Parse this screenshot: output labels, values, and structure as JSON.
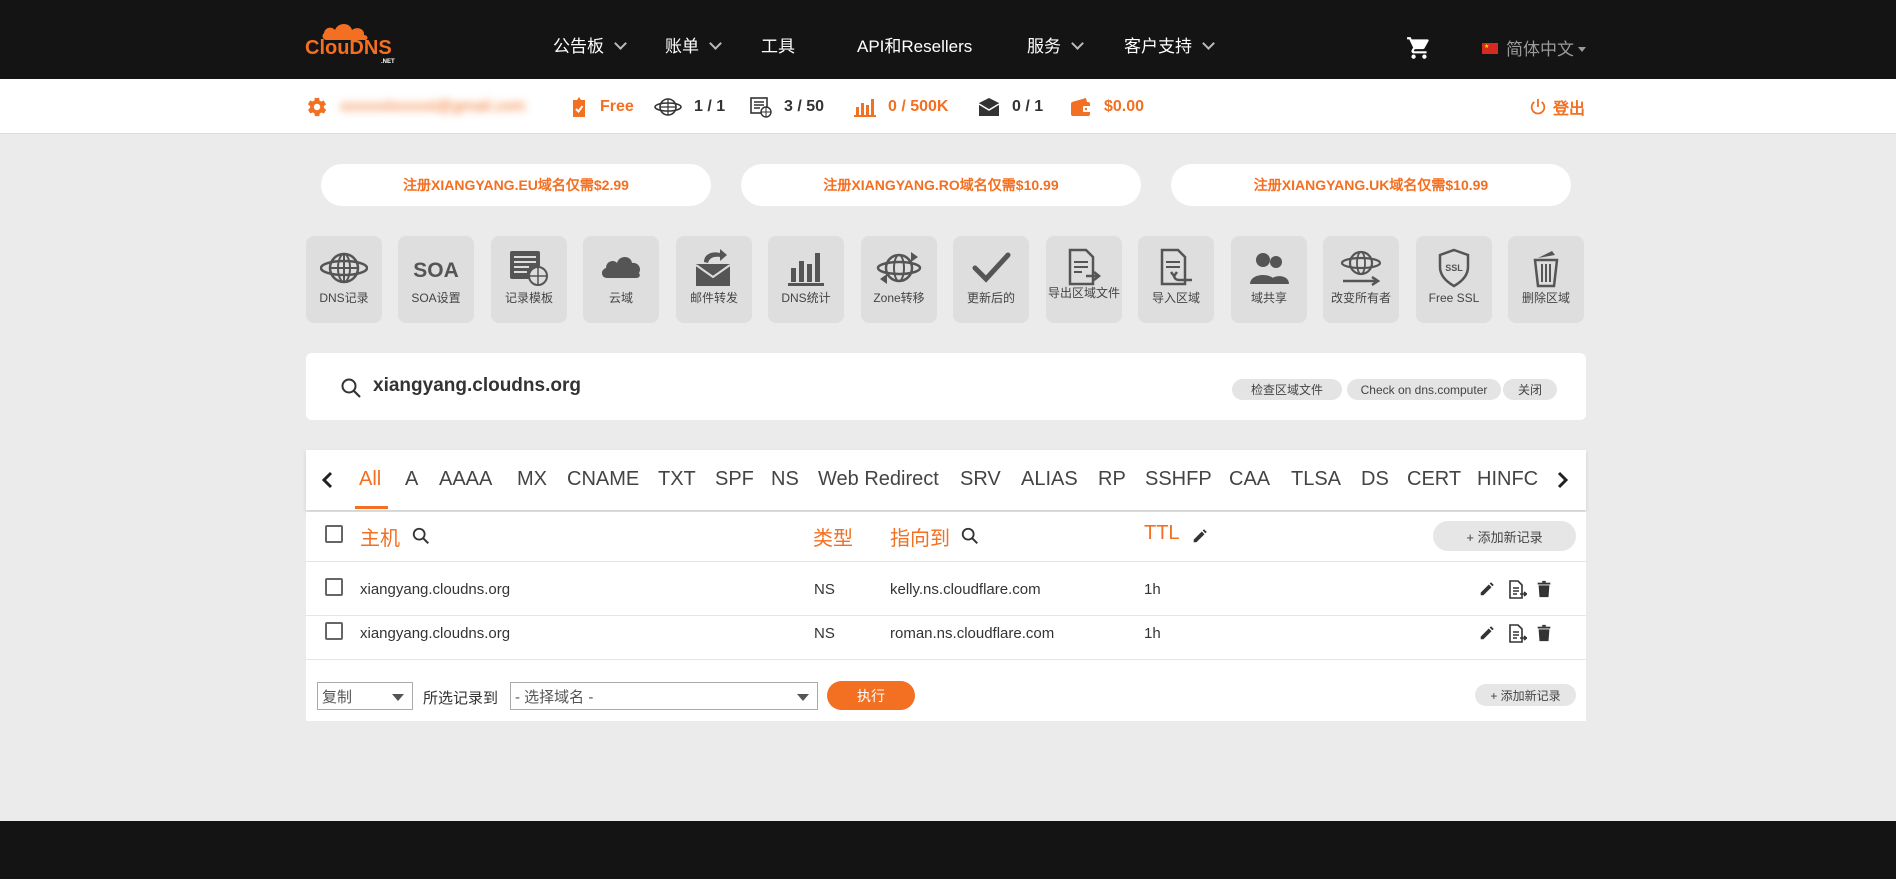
{
  "brand": {
    "logo_text": "ClouDNS",
    "logo_sub": ".NET",
    "accent": "#f36f21"
  },
  "nav": {
    "items": [
      {
        "label": "公告板"
      },
      {
        "label": "账单"
      },
      {
        "label": "工具"
      },
      {
        "label": "API和Resellers"
      },
      {
        "label": "服务"
      },
      {
        "label": "客户支持"
      }
    ],
    "cart_icon": "cart-icon",
    "language": "简体中文"
  },
  "account": {
    "email": "xxxxxxlxxxxxt@gmail.com",
    "plan": "Free",
    "zones": "1 / 1",
    "records": "3 / 50",
    "queries": "0 / 500K",
    "mail_forwards": "0 / 1",
    "balance": "$0.00",
    "logout": "登出"
  },
  "promos": [
    "注册XIANGYANG.EU域名仅需$2.99",
    "注册XIANGYANG.RO域名仅需$10.99",
    "注册XIANGYANG.UK域名仅需$10.99"
  ],
  "tools": [
    {
      "label": "DNS记录",
      "icon": "globe-icon"
    },
    {
      "label": "SOA设置",
      "icon": "soa-icon"
    },
    {
      "label": "记录模板",
      "icon": "template-icon"
    },
    {
      "label": "云域",
      "icon": "cloud-icon"
    },
    {
      "label": "邮件转发",
      "icon": "mail-forward-icon"
    },
    {
      "label": "DNS统计",
      "icon": "stats-icon"
    },
    {
      "label": "Zone转移",
      "icon": "zone-transfer-icon"
    },
    {
      "label": "更新后的",
      "icon": "check-icon"
    },
    {
      "label": "导出区域文件",
      "icon": "export-icon"
    },
    {
      "label": "导入区域",
      "icon": "import-icon"
    },
    {
      "label": "域共享",
      "icon": "users-icon"
    },
    {
      "label": "改变所有者",
      "icon": "change-owner-icon"
    },
    {
      "label": "Free SSL",
      "icon": "ssl-icon"
    },
    {
      "label": "删除区域",
      "icon": "trash-icon"
    }
  ],
  "zone": {
    "domain": "xiangyang.cloudns.org",
    "check_zone": "检查区域文件",
    "check_dns": "Check on dns.computer",
    "close": "关闭"
  },
  "record_types": [
    "All",
    "A",
    "AAAA",
    "MX",
    "CNAME",
    "TXT",
    "SPF",
    "NS",
    "Web Redirect",
    "SRV",
    "ALIAS",
    "RP",
    "SSHFP",
    "CAA",
    "TLSA",
    "DS",
    "CERT",
    "HINFC"
  ],
  "table": {
    "headers": {
      "host": "主机",
      "type": "类型",
      "points_to": "指向到",
      "ttl": "TTL"
    },
    "add_record": "+ 添加新记录",
    "rows": [
      {
        "host": "xiangyang.cloudns.org",
        "type": "NS",
        "points_to": "kelly.ns.cloudflare.com",
        "ttl": "1h"
      },
      {
        "host": "xiangyang.cloudns.org",
        "type": "NS",
        "points_to": "roman.ns.cloudflare.com",
        "ttl": "1h"
      }
    ]
  },
  "bulk": {
    "action_value": "复制",
    "target_label": "所选记录到",
    "domain_placeholder": "- 选择域名 -",
    "execute": "执行",
    "add_record": "+ 添加新记录"
  }
}
